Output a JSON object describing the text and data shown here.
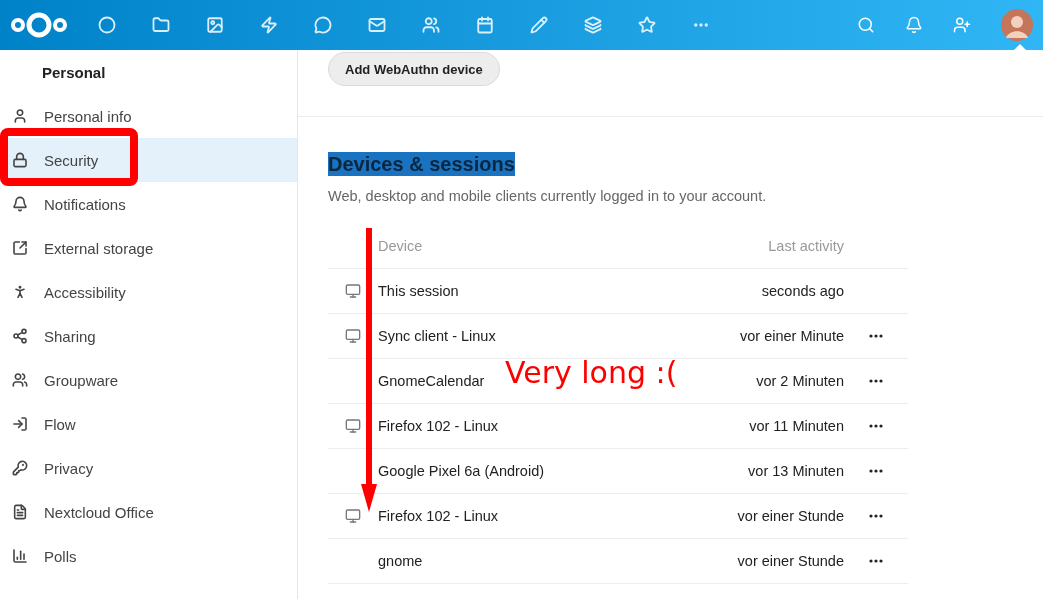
{
  "header": {
    "avatar": true
  },
  "sidebar": {
    "heading": "Personal",
    "items": [
      {
        "label": "Personal info",
        "selected": false
      },
      {
        "label": "Security",
        "selected": true
      },
      {
        "label": "Notifications",
        "selected": false
      },
      {
        "label": "External storage",
        "selected": false
      },
      {
        "label": "Accessibility",
        "selected": false
      },
      {
        "label": "Sharing",
        "selected": false
      },
      {
        "label": "Groupware",
        "selected": false
      },
      {
        "label": "Flow",
        "selected": false
      },
      {
        "label": "Privacy",
        "selected": false
      },
      {
        "label": "Nextcloud Office",
        "selected": false
      },
      {
        "label": "Polls",
        "selected": false
      }
    ]
  },
  "webauthn_button": "Add WebAuthn device",
  "section": {
    "title": "Devices & sessions",
    "title_selected": true,
    "description": "Web, desktop and mobile clients currently logged in to your account."
  },
  "table": {
    "columns": [
      "Device",
      "Last activity"
    ],
    "rows": [
      {
        "kind": "desktop",
        "device": "This session",
        "last_activity": "seconds ago",
        "menu": false
      },
      {
        "kind": "desktop",
        "device": "Sync client - Linux",
        "last_activity": "vor einer Minute",
        "menu": true
      },
      {
        "kind": "app",
        "device": "GnomeCalendar",
        "last_activity": "vor 2 Minuten",
        "menu": true
      },
      {
        "kind": "desktop",
        "device": "Firefox 102 - Linux",
        "last_activity": "vor 11 Minuten",
        "menu": true
      },
      {
        "kind": "app",
        "device": "Google Pixel 6a (Android)",
        "last_activity": "vor 13 Minuten",
        "menu": true
      },
      {
        "kind": "desktop",
        "device": "Firefox 102 - Linux",
        "last_activity": "vor einer Stunde",
        "menu": true
      },
      {
        "kind": "app",
        "device": "gnome",
        "last_activity": "vor einer Stunde",
        "menu": true
      }
    ]
  },
  "annotation": {
    "note": "Very long :(",
    "highlight_box": true,
    "arrow": true
  }
}
